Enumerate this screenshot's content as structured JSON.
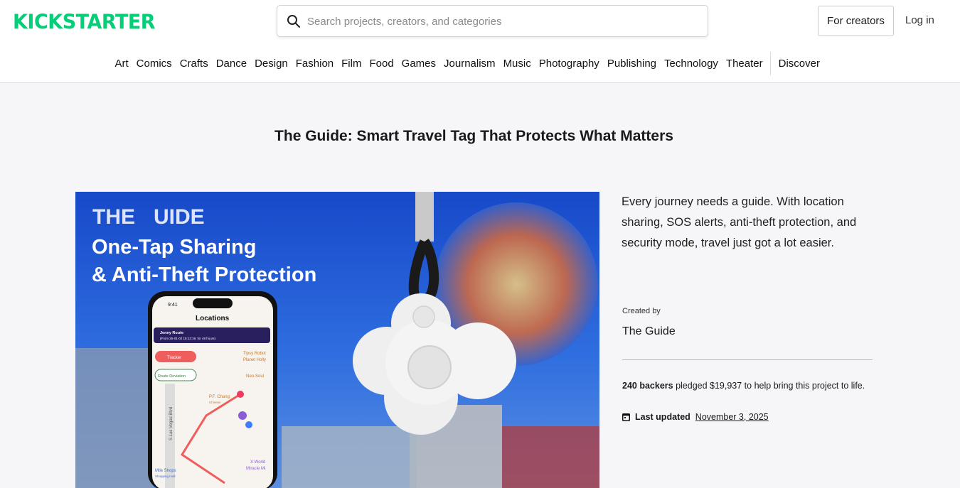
{
  "header": {
    "logo": "KICKSTARTER",
    "search_placeholder": "Search projects, creators, and categories",
    "for_creators": "For creators",
    "log_in": "Log in"
  },
  "categories": [
    "Art",
    "Comics",
    "Crafts",
    "Dance",
    "Design",
    "Fashion",
    "Film",
    "Food",
    "Games",
    "Journalism",
    "Music",
    "Photography",
    "Publishing",
    "Technology",
    "Theater"
  ],
  "discover": "Discover",
  "project": {
    "title": "The Guide: Smart Travel Tag That Protects What Matters",
    "blurb": "Every journey needs a guide. With location sharing, SOS alerts, anti-theft protection, and security mode, travel just got a lot easier.",
    "created_by_label": "Created by",
    "creator": "The Guide",
    "backers": "240 backers",
    "pledged_text": " pledged $19,937 to help bring this project to life.",
    "last_updated_label": "Last updated",
    "last_updated_date": "November 3, 2025"
  },
  "hero": {
    "brand_a": "THE",
    "brand_b": "UIDE",
    "headline_1": "One-Tap Sharing",
    "headline_2": "& Anti-Theft Protection",
    "phone_time": "9:41",
    "phone_title": "Locations",
    "route_name": "Jenny Route",
    "route_detail": "(From 25-01-02 15:13:19, for 48 hours)",
    "tracker": "Tracker",
    "route_deviation": "Route Deviation",
    "places": [
      "Tipsy Robot",
      "Planet Holly",
      "Neo-Soul",
      "P.F. Chang",
      "Chinese",
      "X World",
      "Miracle Mi",
      "Mile Shops",
      "Shopping mall"
    ],
    "street": "S Las Vegas Blvd"
  },
  "colors": {
    "brand": "#05ce78",
    "hero_bg": "#1f5bd6",
    "tag": "#f2f2f2",
    "route": "#ef5d5d",
    "banner": "#2a1f5e"
  }
}
